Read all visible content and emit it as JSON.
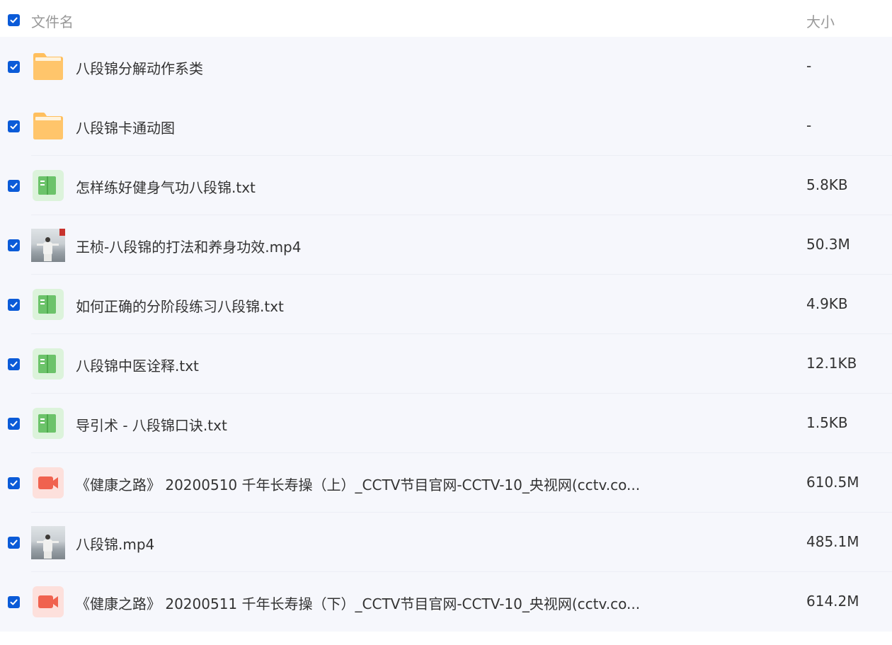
{
  "header": {
    "name_label": "文件名",
    "size_label": "大小"
  },
  "files": [
    {
      "name": "八段锦分解动作系类",
      "size": "-",
      "type": "folder"
    },
    {
      "name": "八段锦卡通动图",
      "size": "-",
      "type": "folder"
    },
    {
      "name": "怎样练好健身气功八段锦.txt",
      "size": "5.8KB",
      "type": "text"
    },
    {
      "name": "王桢-八段锦的打法和养身功效.mp4",
      "size": "50.3M",
      "type": "video-thumbnail"
    },
    {
      "name": "如何正确的分阶段练习八段锦.txt",
      "size": "4.9KB",
      "type": "text"
    },
    {
      "name": "八段锦中医诠释.txt",
      "size": "12.1KB",
      "type": "text"
    },
    {
      "name": "导引术 - 八段锦口诀.txt",
      "size": "1.5KB",
      "type": "text"
    },
    {
      "name": "《健康之路》 20200510 千年长寿操（上）_CCTV节目官网-CCTV-10_央视网(cctv.co...",
      "size": "610.5M",
      "type": "video"
    },
    {
      "name": "八段锦.mp4",
      "size": "485.1M",
      "type": "video-thumbnail"
    },
    {
      "name": "《健康之路》 20200511 千年长寿操（下）_CCTV节目官网-CCTV-10_央视网(cctv.co...",
      "size": "614.2M",
      "type": "video"
    }
  ],
  "colors": {
    "checkbox": "#0b5bd8",
    "row_background": "#f6f7fc",
    "folder": "#ffc56b",
    "text_file": "#6cc36a",
    "video_file": "#f0624f"
  },
  "icons": {
    "folder": "folder-icon",
    "text": "text-file-icon",
    "video": "video-file-icon",
    "video-thumbnail": "video-thumbnail"
  }
}
